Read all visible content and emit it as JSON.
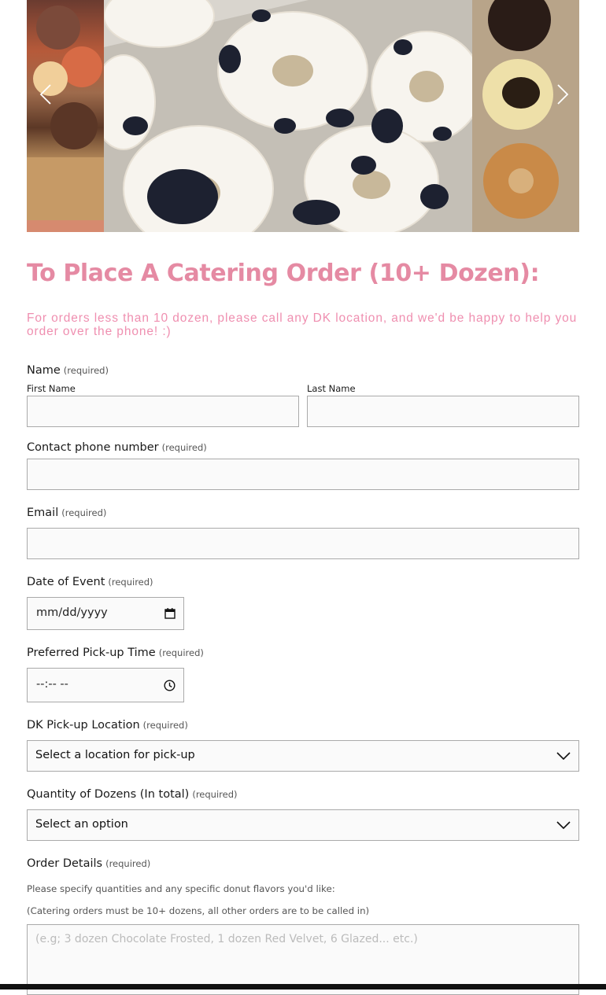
{
  "carousel": {
    "prev_icon": "chevron-left-icon",
    "next_icon": "chevron-right-icon"
  },
  "form": {
    "title": "To Place A Catering Order (10+ Dozen):",
    "subtitle": "For orders less than 10 dozen, please call any DK location, and we'd be happy to help you order over the phone! :)",
    "required_text": "(required)",
    "name": {
      "label": "Name",
      "first_label": "First Name",
      "last_label": "Last Name",
      "first_value": "",
      "last_value": ""
    },
    "phone": {
      "label": "Contact phone number",
      "value": ""
    },
    "email": {
      "label": "Email",
      "value": ""
    },
    "date": {
      "label": "Date of Event",
      "display": "mm/dd/yyyy",
      "icon": "calendar-icon"
    },
    "time": {
      "label": "Preferred Pick-up Time",
      "display": "--:-- --",
      "icon": "clock-icon"
    },
    "location": {
      "label": "DK Pick-up Location",
      "selected": "Select a location for pick-up"
    },
    "quantity": {
      "label": "Quantity of Dozens (In total)",
      "selected": "Select an option"
    },
    "details": {
      "label": "Order Details",
      "help_1": "Please specify quantities and any specific donut flavors you'd like:",
      "help_2": "(Catering orders must be 10+ dozens, all other orders are to be called in)",
      "placeholder": "(e.g; 3 dozen Chocolate Frosted, 1 dozen Red Velvet, 6 Glazed... etc.)"
    }
  },
  "colors": {
    "accent_pink": "#e58aa3",
    "subtitle_pink": "#ef8fb0",
    "field_border": "#aaaaaa"
  }
}
